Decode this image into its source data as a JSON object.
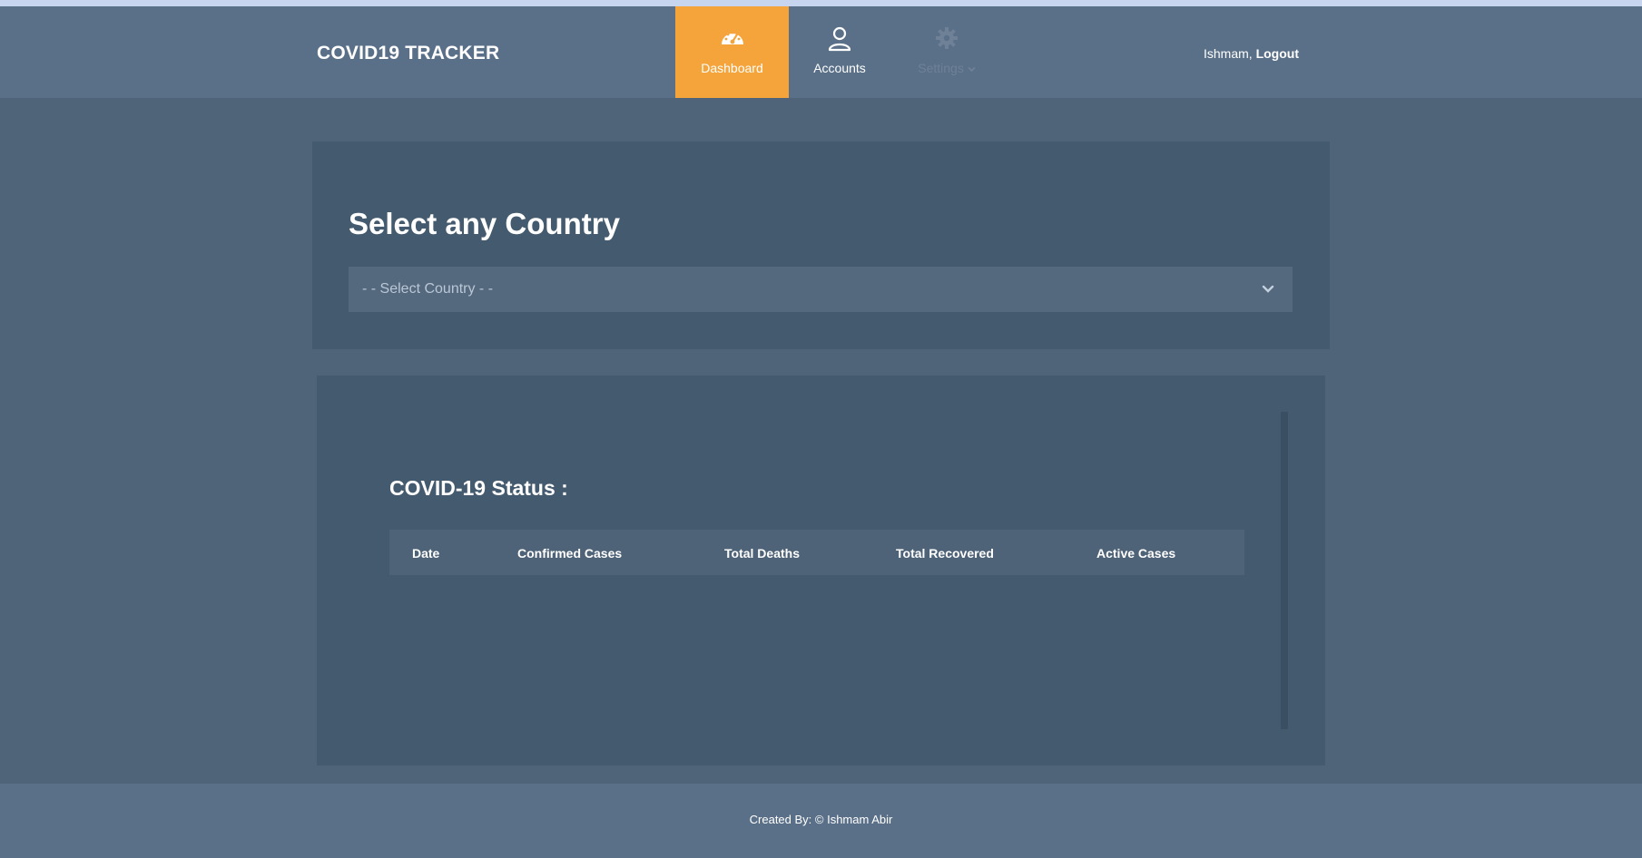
{
  "app": {
    "brand": "COVID19 TRACKER",
    "accent": "#f4a43a"
  },
  "nav": {
    "items": [
      {
        "label": "Dashboard",
        "icon": "speedometer-icon",
        "active": true
      },
      {
        "label": "Accounts",
        "icon": "user-icon",
        "active": false
      },
      {
        "label": "Settings",
        "icon": "gear-icon",
        "active": false,
        "dropdown": true
      }
    ]
  },
  "user": {
    "name": "Ishmam,",
    "logout_label": "Logout"
  },
  "country_select": {
    "heading": "Select any Country",
    "placeholder": "- - Select Country - -"
  },
  "status": {
    "heading": "COVID-19 Status :",
    "columns": [
      "Date",
      "Confirmed Cases",
      "Total Deaths",
      "Total Recovered",
      "Active Cases"
    ],
    "rows": []
  },
  "footer": {
    "text": "Created By: © Ishmam Abir"
  }
}
